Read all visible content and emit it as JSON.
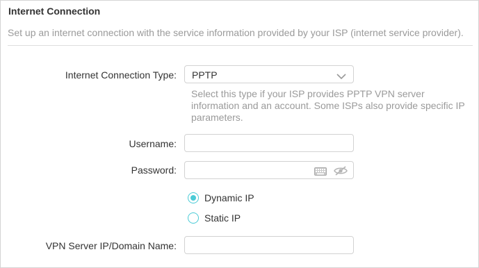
{
  "section": {
    "title": "Internet Connection",
    "description": "Set up an internet connection with the service information provided by your ISP (internet service provider)."
  },
  "form": {
    "connection_type": {
      "label": "Internet Connection Type:",
      "value": "PPTP",
      "hint": "Select this type if your ISP provides PPTP VPN server information and an account. Some ISPs also provide specific IP parameters."
    },
    "username": {
      "label": "Username:",
      "value": ""
    },
    "password": {
      "label": "Password:",
      "value": ""
    },
    "ip_mode": {
      "options": [
        {
          "label": "Dynamic IP",
          "selected": true
        },
        {
          "label": "Static IP",
          "selected": false
        }
      ]
    },
    "vpn_server": {
      "label": "VPN Server IP/Domain Name:",
      "value": ""
    }
  },
  "colors": {
    "accent": "#4acbd6",
    "hint_text": "#9a9a9a",
    "border": "#d2d2d2"
  },
  "icons": [
    "chevron-down-icon",
    "keyboard-icon",
    "eye-off-icon"
  ]
}
